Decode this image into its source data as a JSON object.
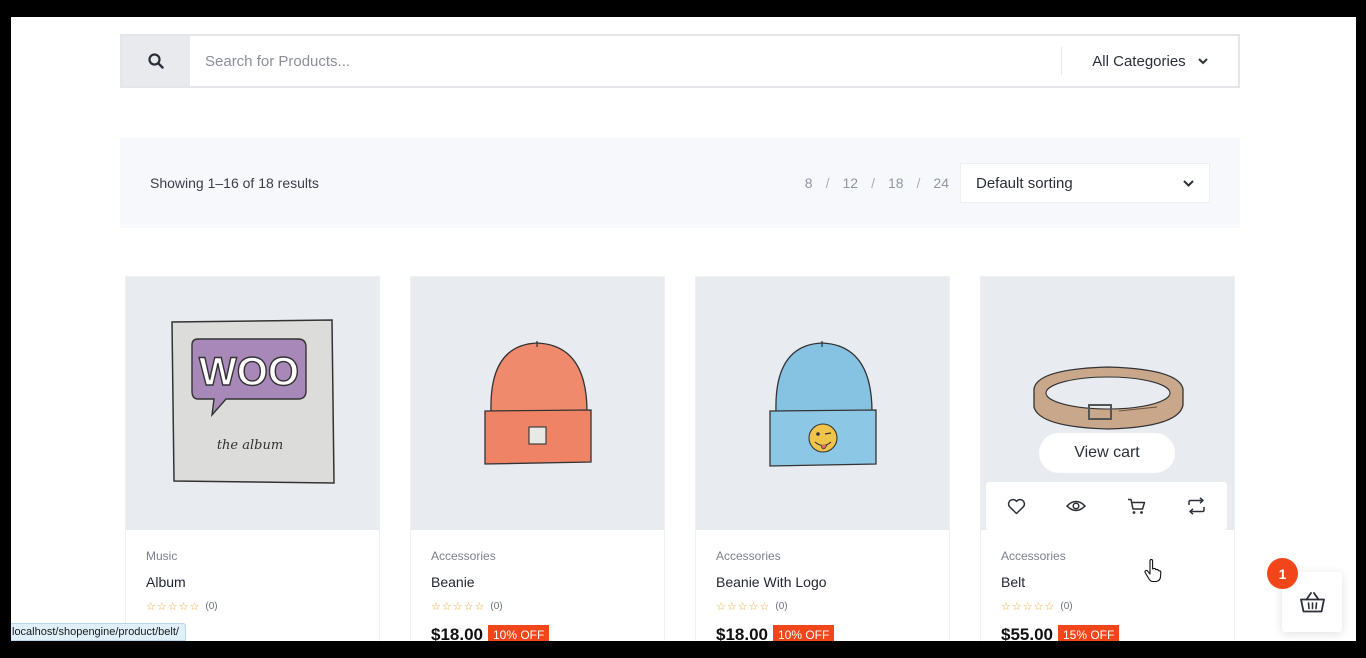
{
  "search": {
    "placeholder": "Search for Products...",
    "category_label": "All Categories"
  },
  "toolbar": {
    "result_count": "Showing 1–16 of 18 results",
    "per_page": [
      "8",
      "12",
      "18",
      "24"
    ],
    "per_page_sep": "/",
    "sort_label": "Default sorting"
  },
  "products": [
    {
      "category": "Music",
      "name": "Album",
      "rating_count": "(0)",
      "price": "",
      "badge": ""
    },
    {
      "category": "Accessories",
      "name": "Beanie",
      "rating_count": "(0)",
      "price": "$18.00",
      "badge": "10% OFF"
    },
    {
      "category": "Accessories",
      "name": "Beanie With Logo",
      "rating_count": "(0)",
      "price": "$18.00",
      "badge": "10% OFF"
    },
    {
      "category": "Accessories",
      "name": "Belt",
      "rating_count": "(0)",
      "price": "$55.00",
      "badge": "15% OFF"
    }
  ],
  "hover_card": {
    "view_cart_label": "View cart",
    "action_icons": [
      "heart-icon",
      "eye-icon",
      "cart-icon",
      "compare-icon"
    ]
  },
  "album_art": {
    "logo_text": "WOO",
    "caption": "the album"
  },
  "mini_cart": {
    "count": "1"
  },
  "status_bar": {
    "url": "localhost/shopengine/product/belt/"
  },
  "colors": {
    "accent": "#f0461a",
    "star": "#f0a832",
    "image_bg": "#e8ebf0"
  }
}
